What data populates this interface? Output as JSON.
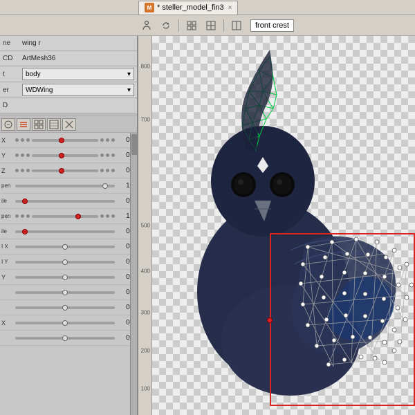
{
  "tab": {
    "icon_label": "M",
    "title": "* steller_model_fin3",
    "close": "×"
  },
  "toolbar": {
    "buttons": [
      "↺",
      "↻",
      "⊞",
      "⊠",
      "⊟"
    ],
    "label": "front crest"
  },
  "left_panel": {
    "rows": [
      {
        "label": "ne",
        "value": "wing r"
      },
      {
        "label": "CD",
        "value": "ArtMesh36"
      },
      {
        "label": "t",
        "dropdown": "body"
      },
      {
        "label": "er",
        "dropdown": "WDWing"
      },
      {
        "label": "D",
        "value": ""
      }
    ]
  },
  "params": [
    {
      "name": "X",
      "pos": "center",
      "red": true,
      "value": "0.0"
    },
    {
      "name": "Y",
      "pos": "center",
      "red": true,
      "value": "0.0"
    },
    {
      "name": "Z",
      "pos": "center",
      "red": true,
      "value": "0.0"
    },
    {
      "name": "pen",
      "pos": "right",
      "red": false,
      "value": "1.0"
    },
    {
      "name": "ile",
      "pos": "left",
      "red": true,
      "value": "0.0"
    },
    {
      "name": "pen",
      "pos": "right",
      "red": false,
      "value": "1.0"
    },
    {
      "name": "ile",
      "pos": "left",
      "red": true,
      "value": "0.0"
    },
    {
      "name": "I X",
      "pos": "center",
      "red": false,
      "value": "0.0"
    },
    {
      "name": "I Y",
      "pos": "center",
      "red": false,
      "value": "0.0"
    },
    {
      "name": "Y",
      "pos": "center",
      "red": false,
      "value": "0.0"
    },
    {
      "name": "",
      "pos": "center",
      "red": false,
      "value": "0.0"
    },
    {
      "name": "",
      "pos": "center",
      "red": false,
      "value": "0.0"
    },
    {
      "name": "X",
      "pos": "center",
      "red": false,
      "value": "0.0"
    },
    {
      "name": "",
      "pos": "center",
      "red": false,
      "value": "0.0"
    }
  ],
  "ruler_marks": [
    {
      "value": "800",
      "pct": 8
    },
    {
      "value": "700",
      "pct": 22
    },
    {
      "value": "500",
      "pct": 50
    },
    {
      "value": "400",
      "pct": 62
    },
    {
      "value": "300",
      "pct": 73
    },
    {
      "value": "200",
      "pct": 83
    },
    {
      "value": "100",
      "pct": 93
    }
  ],
  "colors": {
    "accent_orange": "#e8630a",
    "selection_red": "#dd2222",
    "mesh_green": "#00cc44",
    "bird_body": "#2a3050",
    "bird_head": "#1e2540"
  }
}
